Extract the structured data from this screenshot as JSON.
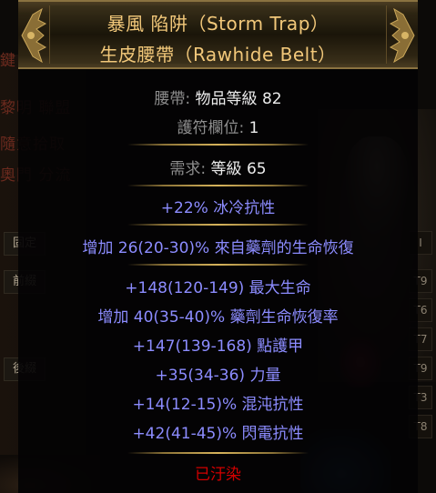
{
  "background": {
    "menu_items": [
      "鍵 · 爆發",
      "黎明 聯盟",
      "隨意拾取",
      "奧門 分流"
    ],
    "affix_labels": [
      "固定",
      "前綴",
      "後綴"
    ],
    "tier_slots": [
      "I",
      "T9",
      "T6",
      "T7",
      "T9",
      "T3",
      "T8"
    ]
  },
  "item": {
    "name_line1": "暴風 陷阱（Storm Trap）",
    "name_line2": "生皮腰帶（Rawhide Belt）",
    "type_label": "腰帶:",
    "item_level": "物品等級 82",
    "charm_label": "護符欄位:",
    "charm_value": "1",
    "requirement_label": "需求:",
    "requirement_value": "等級 65",
    "implicit": "+22% 冰冷抗性",
    "enchant": "增加 26(20-30)% 來自藥劑的生命恢復",
    "mods": [
      "+148(120-149) 最大生命",
      "增加 40(35-40)% 藥劑生命恢復率",
      "+147(139-168) 點護甲",
      "+35(34-36) 力量",
      "+14(12-15)% 混沌抗性",
      "+42(41-45)% 閃電抗性"
    ],
    "corrupted": "已汙染"
  },
  "colors": {
    "header_text": "#f2c87a",
    "magic_mod": "#8c8cff",
    "corrupted": "#d20000",
    "property_grey": "#8e8e8e"
  }
}
